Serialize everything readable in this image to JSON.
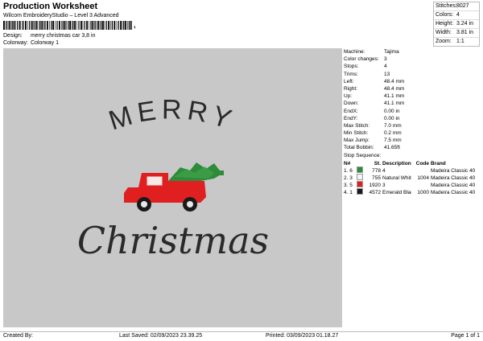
{
  "header": {
    "title": "Production Worksheet",
    "subtitle": "Wilcom EmbroideryStudio – Level 3 Advanced",
    "barcode_suffix": ","
  },
  "design": {
    "label": "Design:",
    "value": "merry christmas car 3,8 in"
  },
  "colorway": {
    "label": "Colorway:",
    "value": "Colorway 1"
  },
  "stats": [
    {
      "k": "Stitches:",
      "v": "8027"
    },
    {
      "k": "Colors:",
      "v": "4"
    },
    {
      "k": "Height:",
      "v": "3.24 in"
    },
    {
      "k": "Width:",
      "v": "3.81 in"
    },
    {
      "k": "Zoom:",
      "v": "1:1"
    }
  ],
  "artwork": {
    "merry": "MERRY",
    "christmas": "Christmas",
    "colors": {
      "truck": "#e02020",
      "tree": "#2e8b3a",
      "text": "#2a2a2a",
      "canvas": "#c8c8c8"
    }
  },
  "machine": [
    {
      "k": "Machine:",
      "v": "Tajima"
    },
    {
      "k": "Color changes:",
      "v": "3"
    },
    {
      "k": "Stops:",
      "v": "4"
    },
    {
      "k": "Trims:",
      "v": "13"
    },
    {
      "k": "Left:",
      "v": "48.4 mm"
    },
    {
      "k": "Right:",
      "v": "48.4 mm"
    },
    {
      "k": "Up:",
      "v": "41.1 mm"
    },
    {
      "k": "Down:",
      "v": "41.1 mm"
    },
    {
      "k": "EndX:",
      "v": "0.00 in"
    },
    {
      "k": "EndY:",
      "v": "0.00 in"
    },
    {
      "k": "Max Stitch:",
      "v": "7.0 mm"
    },
    {
      "k": "Min Stitch:",
      "v": "0.2 mm"
    },
    {
      "k": "Max Jump:",
      "v": "7.5 mm"
    },
    {
      "k": "Total Bobbin:",
      "v": "41.65ft"
    }
  ],
  "sequence": {
    "label": "Stop Sequence:",
    "headers": {
      "n": "N#",
      "st": "St.",
      "desc": "Description",
      "code": "Code",
      "brand": "Brand"
    },
    "rows": [
      {
        "n": "1.",
        "color_n": "6",
        "color": "#2e8b3a",
        "st": "778",
        "desc": "4",
        "code": "",
        "brand": "Madeira Classic 40"
      },
      {
        "n": "2.",
        "color_n": "3",
        "color": "#f4f4f4",
        "st": "755",
        "desc": "Natural White",
        "code": "1004",
        "brand": "Madeira Classic 40"
      },
      {
        "n": "3.",
        "color_n": "5",
        "color": "#e02020",
        "st": "1920",
        "desc": "3",
        "code": "",
        "brand": "Madeira Classic 40"
      },
      {
        "n": "4.",
        "color_n": "1",
        "color": "#1a1a1a",
        "st": "4572",
        "desc": "Emerald Black",
        "code": "1000",
        "brand": "Madeira Classic 40"
      }
    ]
  },
  "footer": {
    "created_by": "Created By:",
    "last_saved": "Last Saved: 02/09/2023 23.39.25",
    "printed": "Printed: 03/09/2023 01.18.27",
    "page": "Page 1 of 1"
  }
}
